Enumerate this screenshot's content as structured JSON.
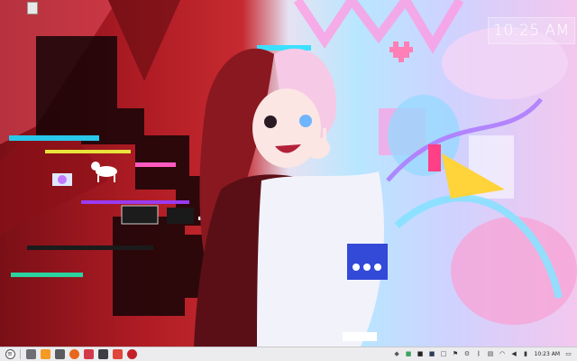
{
  "desktop": {
    "clock_widget": {
      "time": "10:25 AM"
    }
  },
  "taskbar": {
    "launcher": {
      "icon": "menu-icon"
    },
    "pinned": [
      {
        "name": "show-desktop",
        "icon": "desktop-icon",
        "color": "#6e6e74"
      },
      {
        "name": "files",
        "icon": "folder-icon",
        "color": "#f59a23"
      },
      {
        "name": "app-store",
        "icon": "store-icon",
        "color": "#5a5a5f"
      },
      {
        "name": "browser",
        "icon": "browser-icon",
        "color": "#e9661e"
      },
      {
        "name": "media",
        "icon": "media-icon",
        "color": "#d23a4a"
      },
      {
        "name": "text-editor",
        "icon": "text-icon",
        "color": "#3d3d45"
      },
      {
        "name": "graphics",
        "icon": "paint-icon",
        "color": "#e0463a"
      },
      {
        "name": "game",
        "icon": "game-icon",
        "color": "#c5202a"
      }
    ],
    "tray": [
      {
        "name": "tray-app-1",
        "icon": "shield-icon",
        "color": "#555"
      },
      {
        "name": "tray-app-2",
        "icon": "puzzle-icon",
        "color": "#3aa35a"
      },
      {
        "name": "tray-app-3",
        "icon": "terminal-icon",
        "color": "#222"
      },
      {
        "name": "tray-app-4",
        "icon": "chip-icon",
        "color": "#2b3b58"
      },
      {
        "name": "tray-app-5",
        "icon": "square-icon",
        "color": "#444"
      },
      {
        "name": "tray-app-6",
        "icon": "flag-icon",
        "color": "#333"
      },
      {
        "name": "tray-app-7",
        "icon": "gear-icon",
        "color": "#555"
      },
      {
        "name": "tray-app-8",
        "icon": "bluetooth-icon",
        "color": "#333"
      },
      {
        "name": "tray-app-9",
        "icon": "clipboard-icon",
        "color": "#444"
      },
      {
        "name": "tray-app-10",
        "icon": "wifi-icon",
        "color": "#333"
      },
      {
        "name": "tray-app-11",
        "icon": "volume-icon",
        "color": "#333"
      },
      {
        "name": "tray-app-12",
        "icon": "battery-icon",
        "color": "#333"
      }
    ],
    "clock": "10:23 AM",
    "notifications": {
      "icon": "notification-icon"
    }
  }
}
